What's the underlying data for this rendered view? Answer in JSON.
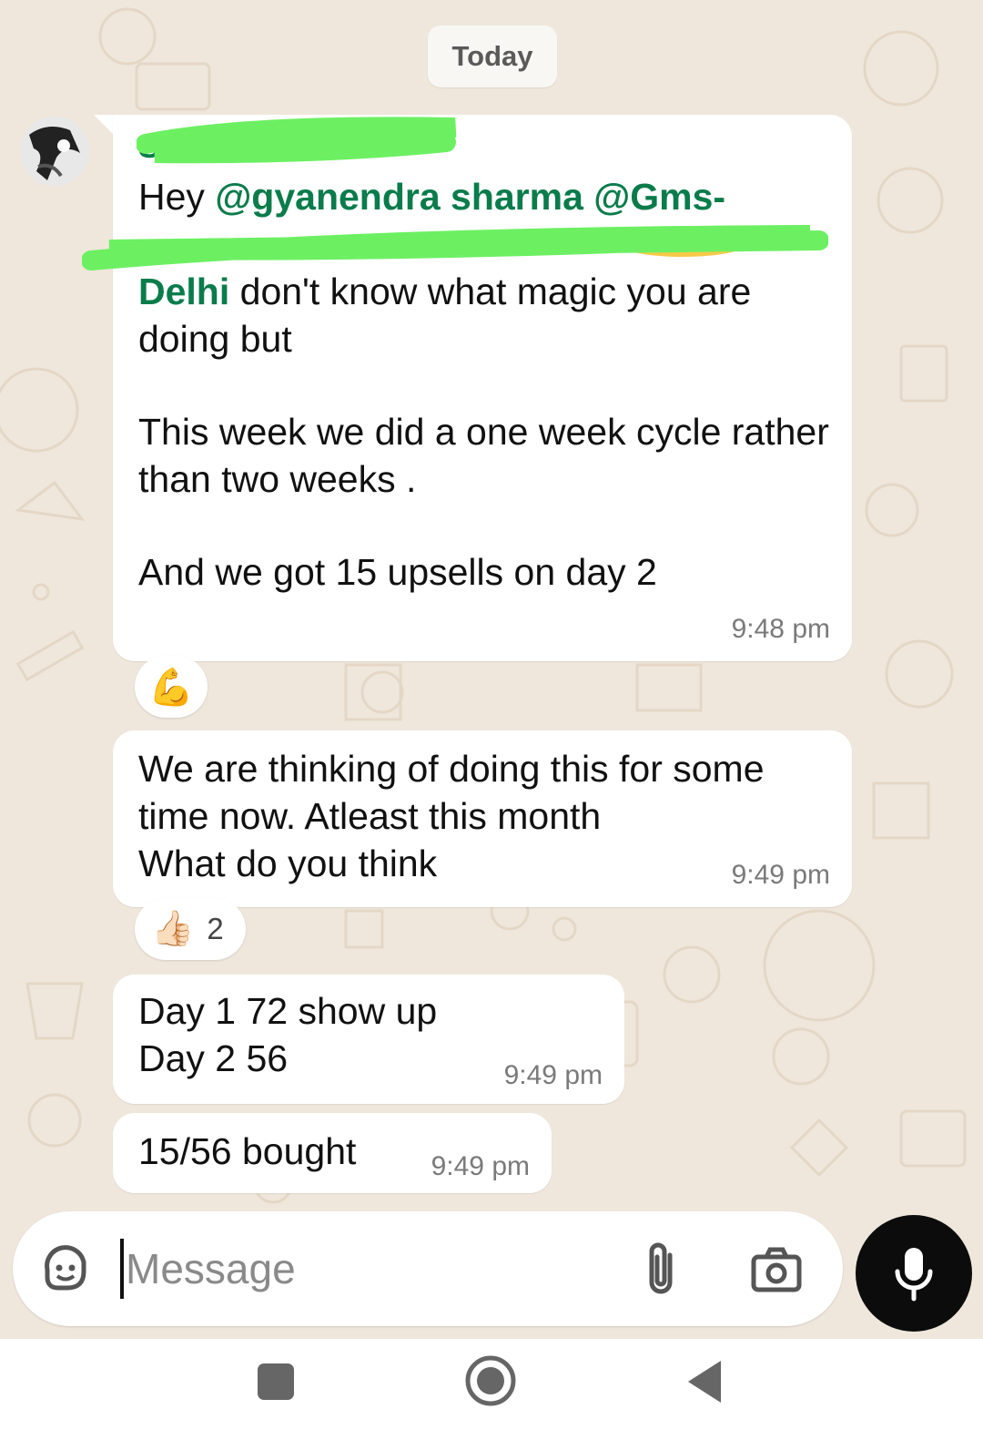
{
  "date_chip": "Today",
  "messages": [
    {
      "sender": "S",
      "text_hey": "Hey ",
      "mention1": "@gyanendra sharma",
      "mention2": "@Gms-",
      "mention3": "Delhi",
      "text_after": " don't know what magic you are doing but",
      "para2": "This week we did a one week cycle rather than two weeks .",
      "para3": "And we got 15 upsells on day 2",
      "time": "9:48 pm",
      "reaction": "💪"
    },
    {
      "text": "We are thinking of doing this for some time now. Atleast this month\nWhat do you think",
      "time": "9:49 pm",
      "reaction": "👍🏻",
      "reaction_count": "2"
    },
    {
      "text": "Day 1 72 show up\nDay 2 56",
      "time": "9:49 pm"
    },
    {
      "text": "15/56 bought",
      "time": "9:49 pm"
    }
  ],
  "composer": {
    "placeholder": "Message"
  },
  "icons": [
    "sticker-icon",
    "attach-icon",
    "camera-icon",
    "mic-icon",
    "nav-recents-icon",
    "nav-home-icon",
    "nav-back-icon"
  ],
  "colors": {
    "mention": "#0a7c4b",
    "wallpaper": "#efe7dc",
    "bubble": "#ffffff",
    "highlight": "#6cf062"
  }
}
